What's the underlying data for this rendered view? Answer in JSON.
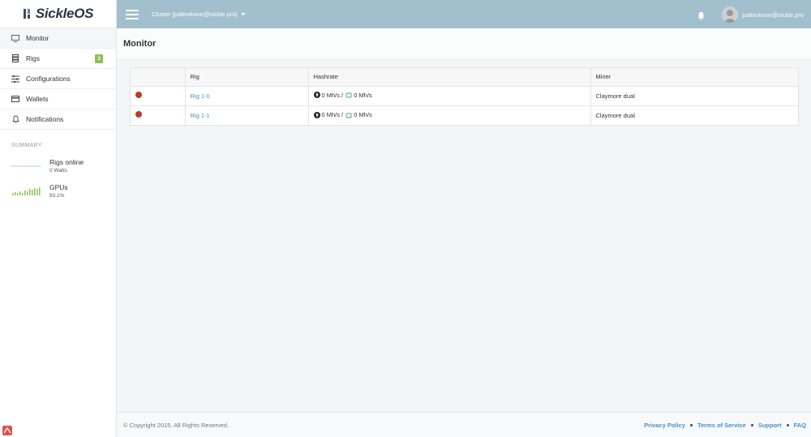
{
  "brand": {
    "name": "SickleOS"
  },
  "topbar": {
    "cluster_label": "Cluster [paltovkone@sickle.pro]",
    "user_name": "paltovkone@sickle.pro"
  },
  "sidebar": {
    "items": [
      {
        "label": "Monitor",
        "icon": "monitor-icon",
        "active": true
      },
      {
        "label": "Rigs",
        "icon": "server-icon",
        "badge": "2"
      },
      {
        "label": "Configurations",
        "icon": "sliders-icon"
      },
      {
        "label": "Wallets",
        "icon": "credit-card-icon"
      },
      {
        "label": "Notifications",
        "icon": "bell-icon"
      }
    ],
    "summary_title": "SUMMARY",
    "summary": [
      {
        "name": "Rigs online",
        "value": "0 Watts"
      },
      {
        "name": "GPUs",
        "value": "83.1%"
      }
    ]
  },
  "page": {
    "title": "Monitor"
  },
  "table": {
    "headers": [
      "",
      "Rig",
      "Hashrate",
      "Miner"
    ],
    "rows": [
      {
        "status": "offline",
        "rig": "Rig 1-0",
        "hash_primary": "0 Mh/s /",
        "hash_secondary": "0 Mh/s",
        "miner": "Claymore dual"
      },
      {
        "status": "offline",
        "rig": "Rig 1-1",
        "hash_primary": "0 Mh/s /",
        "hash_secondary": "0 Mh/s",
        "miner": "Claymore dual"
      }
    ]
  },
  "footer": {
    "copyright": "© Copyright 2015. All Rights Reserved.",
    "links": [
      "Privacy Policy",
      "Terms of Service",
      "Support",
      "FAQ"
    ]
  },
  "colors": {
    "topbar": "#a2bfcd",
    "accent_link": "#4a90c8",
    "badge": "#8cc152",
    "status_offline": "#c0392b",
    "spark_green": "#8cc152"
  }
}
